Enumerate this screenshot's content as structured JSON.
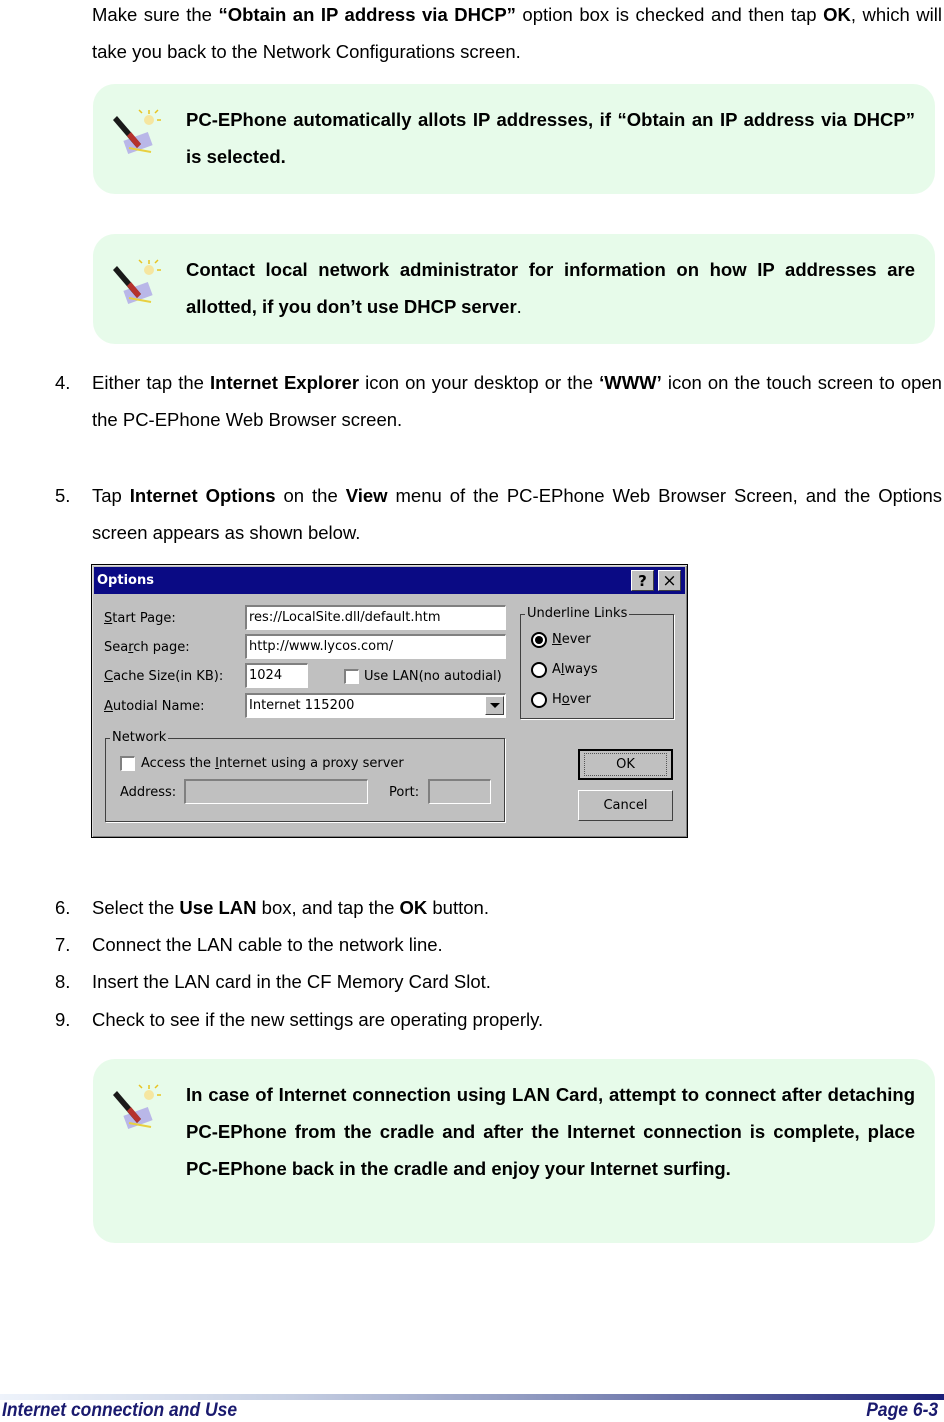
{
  "intro": {
    "pre": "Make sure the ",
    "bold1": "“Obtain an IP address via DHCP”",
    "mid": " option box is checked and then tap ",
    "bold2": "OK",
    "post": ", which will take you back to the Network Configurations screen."
  },
  "notes": [
    {
      "icon": "note-pen-icon",
      "text": "PC-EPhone automatically allots IP addresses, if “Obtain an IP address via DHCP” is selected."
    },
    {
      "icon": "note-pen-icon",
      "text": "Contact local network administrator for information on how IP addresses are allotted, if you don’t use DHCP server",
      "trail": "."
    },
    {
      "icon": "note-pen-icon",
      "text": "In case of Internet connection using LAN Card, attempt to connect after detaching PC-EPhone from the cradle and after the Internet connection is complete, place PC-EPhone back in the cradle and enjoy your Internet surfing."
    }
  ],
  "steps": {
    "s4": {
      "num": "4.",
      "a": "Either tap the ",
      "b1": "Internet Explorer",
      "c": " icon on your desktop or the ",
      "b2": "‘WWW’",
      "d": " icon on the touch screen to open the PC-EPhone Web Browser screen."
    },
    "s5": {
      "num": "5.",
      "a": "Tap ",
      "b1": "Internet Options",
      "c": " on the ",
      "b2": "View",
      "d": " menu of the PC-EPhone Web Browser Screen, and the Options screen appears as shown below."
    },
    "s6": {
      "num": "6.",
      "a": "Select the ",
      "b1": "Use LAN",
      "c": " box, and tap the ",
      "b2": "OK",
      "d": " button."
    },
    "s7": {
      "num": "7.",
      "text": "Connect the LAN cable to the network line."
    },
    "s8": {
      "num": "8.",
      "text": "Insert the LAN card in the CF Memory Card Slot."
    },
    "s9": {
      "num": "9.",
      "text": "Check to see if the new settings are operating properly."
    }
  },
  "dialog": {
    "title": "Options",
    "help_button": "?",
    "close_button": "×",
    "start_page": {
      "label_u": "S",
      "label_rest": "tart Page:",
      "value": "res://LocalSite.dll/default.htm"
    },
    "search_page": {
      "label_pre": "Sea",
      "label_u": "r",
      "label_rest": "ch page:",
      "value": "http://www.lycos.com/"
    },
    "cache_size": {
      "label_u": "C",
      "label_rest": "ache Size(in KB):",
      "value": "1024"
    },
    "use_lan": {
      "label": "Use LAN(no autodial)",
      "checked": false
    },
    "autodial": {
      "label_u": "A",
      "label_rest": "utodial Name:",
      "value": "Internet 115200"
    },
    "underline_links": {
      "legend": "Underline Links",
      "options": [
        {
          "pre": "",
          "u": "N",
          "rest": "ever",
          "selected": true
        },
        {
          "pre": "A",
          "u": "l",
          "rest": "ways",
          "selected": false
        },
        {
          "pre": "H",
          "u": "o",
          "rest": "ver",
          "selected": false
        }
      ]
    },
    "network": {
      "legend": "Network",
      "proxy": {
        "pre": "Access the ",
        "u": "I",
        "rest": "nternet using a proxy server",
        "checked": false
      },
      "address_label": "Address:",
      "address_value": "",
      "port_label": "Port:",
      "port_value": ""
    },
    "ok_button": "OK",
    "cancel_button": "Cancel"
  },
  "footer": {
    "section": "Internet connection and Use",
    "page": "Page 6-3"
  }
}
